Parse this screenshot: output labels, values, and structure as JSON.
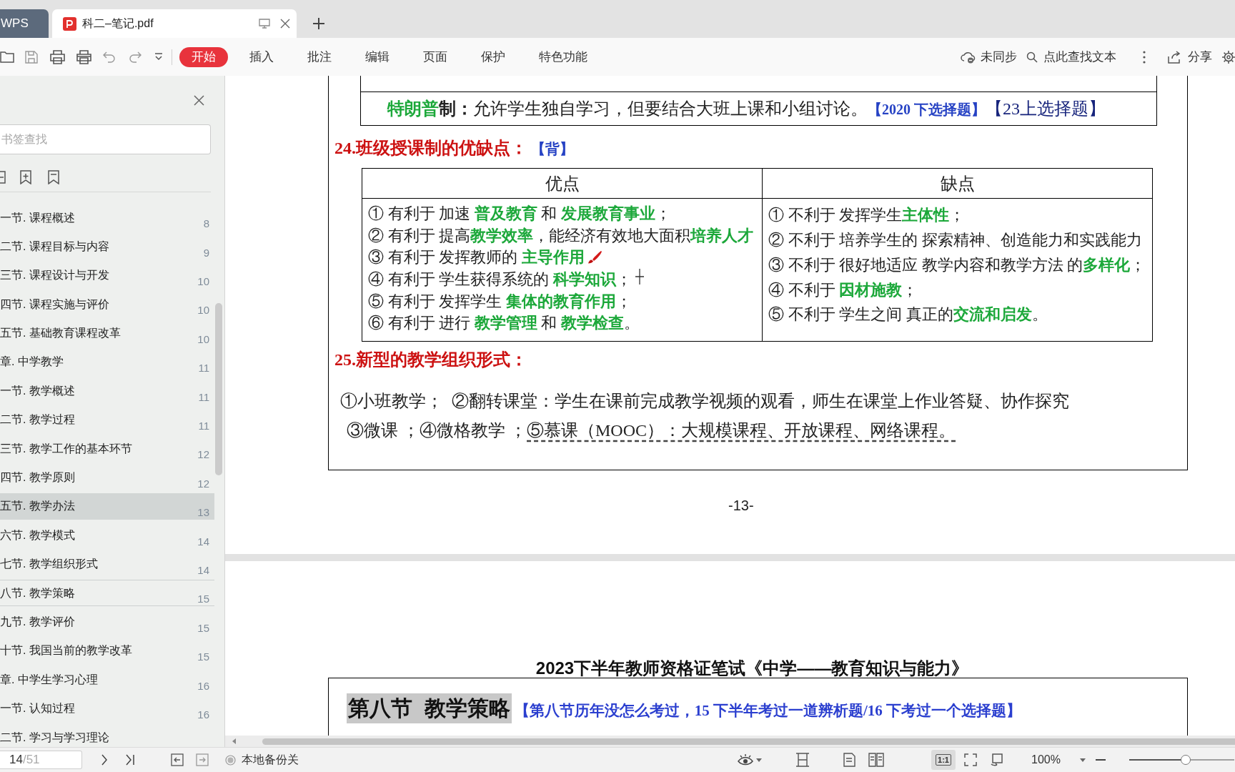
{
  "tabs": [
    {
      "label": "WPS",
      "kind": "home",
      "selected": false
    },
    {
      "label": "科二–笔记.pdf",
      "kind": "document",
      "selected": true
    }
  ],
  "toolbar": {
    "menu": [
      {
        "label": "开始",
        "selected": true
      },
      {
        "label": "插入",
        "selected": false
      },
      {
        "label": "批注",
        "selected": false
      },
      {
        "label": "编辑",
        "selected": false
      },
      {
        "label": "页面",
        "selected": false
      },
      {
        "label": "保护",
        "selected": false
      },
      {
        "label": "特色功能",
        "selected": false
      }
    ],
    "sync_status": "未同步",
    "find_text": "点此查找文本",
    "share": "分享"
  },
  "sidebar": {
    "search": {
      "placeholder": "书签查找"
    },
    "bookmarks": [
      {
        "title": "一节. 课程概述",
        "page": "8",
        "selected": false,
        "hovered": false
      },
      {
        "title": "二节. 课程目标与内容",
        "page": "9",
        "selected": false,
        "hovered": false
      },
      {
        "title": "三节. 课程设计与开发",
        "page": "10",
        "selected": false,
        "hovered": false
      },
      {
        "title": "四节. 课程实施与评价",
        "page": "10",
        "selected": false,
        "hovered": false
      },
      {
        "title": "五节. 基础教育课程改革",
        "page": "10",
        "selected": false,
        "hovered": false
      },
      {
        "title": "章. 中学教学",
        "page": "11",
        "selected": false,
        "hovered": false
      },
      {
        "title": "一节. 教学概述",
        "page": "11",
        "selected": false,
        "hovered": false
      },
      {
        "title": "二节. 教学过程",
        "page": "11",
        "selected": false,
        "hovered": false
      },
      {
        "title": "三节. 教学工作的基本环节",
        "page": "12",
        "selected": false,
        "hovered": false
      },
      {
        "title": "四节. 教学原则",
        "page": "12",
        "selected": false,
        "hovered": false
      },
      {
        "title": "五节. 教学办法",
        "page": "13",
        "selected": true,
        "hovered": false
      },
      {
        "title": "六节. 教学模式",
        "page": "14",
        "selected": false,
        "hovered": false
      },
      {
        "title": "七节. 教学组织形式",
        "page": "14",
        "selected": false,
        "hovered": false
      },
      {
        "title": "八节. 教学策略",
        "page": "15",
        "selected": false,
        "hovered": true
      },
      {
        "title": "九节. 教学评价",
        "page": "15",
        "selected": false,
        "hovered": false
      },
      {
        "title": "十节. 我国当前的教学改革",
        "page": "15",
        "selected": false,
        "hovered": false
      },
      {
        "title": "章. 中学生学习心理",
        "page": "16",
        "selected": false,
        "hovered": false
      },
      {
        "title": "一节. 认知过程",
        "page": "16",
        "selected": false,
        "hovered": false
      },
      {
        "title": "二节. 学习与学习理论",
        "selected": false,
        "hovered": false
      }
    ]
  },
  "document": {
    "method_row": [
      {
        "text": "特朗普",
        "kind": "green"
      },
      {
        "text": "制：",
        "kind": "bold"
      },
      {
        "text": "允许学生独自学习，但要结合大班上课和小组讨论。",
        "kind": "plain"
      },
      {
        "text": "【2020 下选择题】",
        "kind": "blue"
      },
      {
        "text": "【23上选择题】",
        "kind": "navy"
      }
    ],
    "heading_24": [
      {
        "text": "24.班级授课制的优缺点：",
        "kind": "red"
      },
      {
        "text": " 【背】",
        "kind": "blue"
      }
    ],
    "table": {
      "columns": [
        "优点",
        "缺点"
      ],
      "cells": [
        [
          {
            "segments": [
              {
                "text": "① 有利于 加速 ",
                "kind": "plain"
              },
              {
                "text": "普及教育",
                "kind": "green"
              },
              {
                "text": " 和 ",
                "kind": "plain"
              },
              {
                "text": "发展教育事业",
                "kind": "green"
              },
              {
                "text": "；",
                "kind": "plain"
              }
            ]
          },
          {
            "segments": [
              {
                "text": "② 有利于 提高",
                "kind": "plain"
              },
              {
                "text": "教学效率",
                "kind": "green"
              },
              {
                "text": "，能经济有效地大面积",
                "kind": "plain"
              },
              {
                "text": "培养人才",
                "kind": "green"
              }
            ]
          },
          {
            "segments": [
              {
                "text": "③ 有利于 发挥教师的 ",
                "kind": "plain"
              },
              {
                "text": "主导作用",
                "kind": "green"
              }
            ],
            "pen_mark": true
          },
          {
            "segments": [
              {
                "text": "④ 有利于 学生获得系统的 ",
                "kind": "plain"
              },
              {
                "text": "科学知识",
                "kind": "green"
              },
              {
                "text": "；",
                "kind": "plain"
              }
            ]
          },
          {
            "segments": [
              {
                "text": "⑤ 有利于 发挥学生 ",
                "kind": "plain"
              },
              {
                "text": "集体的教育作用",
                "kind": "green"
              },
              {
                "text": "；",
                "kind": "plain"
              }
            ]
          },
          {
            "segments": [
              {
                "text": "⑥ 有利于 进行 ",
                "kind": "plain"
              },
              {
                "text": "教学管理",
                "kind": "green"
              },
              {
                "text": " 和 ",
                "kind": "plain"
              },
              {
                "text": "教学检查",
                "kind": "green"
              },
              {
                "text": "。",
                "kind": "plain"
              }
            ]
          }
        ],
        [
          {
            "segments": [
              {
                "text": "① 不利于 发挥学生",
                "kind": "plain"
              },
              {
                "text": "主体性",
                "kind": "green"
              },
              {
                "text": "；",
                "kind": "plain"
              }
            ]
          },
          {
            "segments": [
              {
                "text": "② 不利于 培养学生的 探索精神、创造能力和实践能力",
                "kind": "plain"
              }
            ]
          },
          {
            "segments": [
              {
                "text": "③ 不利于 很好地适应 教学内容和教学方法 的",
                "kind": "plain"
              },
              {
                "text": "多样化",
                "kind": "green"
              },
              {
                "text": "；",
                "kind": "plain"
              }
            ]
          },
          {
            "segments": [
              {
                "text": "④ 不利于 ",
                "kind": "plain"
              },
              {
                "text": "因材施教",
                "kind": "green"
              },
              {
                "text": "；",
                "kind": "plain"
              }
            ]
          },
          {
            "segments": [
              {
                "text": "⑤ 不利于 学生之间 真正的",
                "kind": "plain"
              },
              {
                "text": "交流和启发",
                "kind": "green"
              },
              {
                "text": "。",
                "kind": "plain"
              }
            ]
          }
        ]
      ]
    },
    "heading_25": [
      {
        "text": "25.新型的教学组织形式：",
        "kind": "red"
      }
    ],
    "forms": [
      [
        {
          "text": "①小班教学；  ②翻转课堂：学生在课前完成教学视频的观看，师生在课堂上作业答疑、协作探究",
          "kind": "plain"
        }
      ],
      [
        {
          "text": "③微课 ；④微格教学 ；",
          "kind": "plain"
        },
        {
          "text": "⑤慕课（MOOC）：大规模课程、开放课程、网络课程。",
          "kind": "dotted"
        }
      ]
    ],
    "page_number": "-13-",
    "next_page": {
      "header": "2023下半年教师资格证笔试《中学——教育知识与能力》",
      "section_title": "第八节  教学策略",
      "section_note": "【第八节历年没怎么考过，15 下半年考过一道辨析题/16 下考过一个选择题】"
    }
  },
  "status_bar": {
    "page": "14",
    "page_total": "/51",
    "backup": "本地备份关",
    "zoom_modes": [
      {
        "kind": "actual",
        "label": "1:1",
        "selected": true
      },
      {
        "kind": "fit",
        "selected": false
      },
      {
        "kind": "rotate",
        "selected": false
      }
    ],
    "zoom": "100%",
    "zoom_slider": {
      "level": 0.54
    }
  }
}
